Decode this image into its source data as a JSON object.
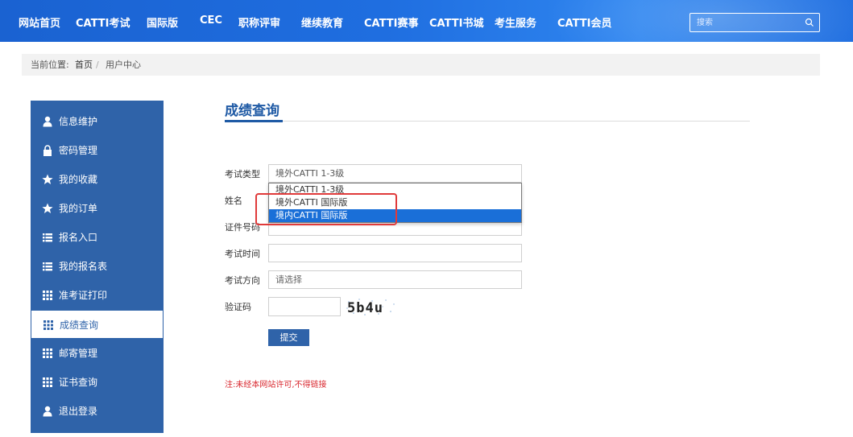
{
  "nav": {
    "items": [
      "网站首页",
      "CATTI考试",
      "国际版",
      "CEC",
      "职称评审",
      "继续教育",
      "CATTI赛事",
      "CATTI书城",
      "考生服务",
      "CATTI会员"
    ],
    "search_placeholder": "搜索",
    "brand_color": "#1f6ee0"
  },
  "breadcrumb": {
    "prefix": "当前位置:",
    "home": "首页",
    "sep": "/",
    "current": "用户中心"
  },
  "sidebar": {
    "items": [
      {
        "label": "信息维护",
        "icon": "user-icon"
      },
      {
        "label": "密码管理",
        "icon": "lock-icon"
      },
      {
        "label": "我的收藏",
        "icon": "star-icon"
      },
      {
        "label": "我的订单",
        "icon": "star-icon"
      },
      {
        "label": "报名入口",
        "icon": "list-icon"
      },
      {
        "label": "我的报名表",
        "icon": "list-icon"
      },
      {
        "label": "准考证打印",
        "icon": "grid-icon"
      },
      {
        "label": "成绩查询",
        "icon": "grid-icon",
        "active": true
      },
      {
        "label": "邮寄管理",
        "icon": "grid-icon"
      },
      {
        "label": "证书查询",
        "icon": "grid-icon"
      },
      {
        "label": "退出登录",
        "icon": "user-icon"
      }
    ],
    "bg_color": "#2f63a9"
  },
  "main": {
    "title": "成绩查询",
    "form": {
      "exam_type_label": "考试类型",
      "exam_type_value": "境外CATTI 1-3级",
      "name_label": "姓名",
      "id_label": "证件号码",
      "exam_time_label": "考试时间",
      "direction_label": "考试方向",
      "direction_placeholder": "请选择",
      "captcha_label": "验证码",
      "captcha_text": "5b4u",
      "submit_label": "提交"
    },
    "dropdown_options": [
      "境外CATTI 1-3级",
      "境外CATTI 国际版",
      "境内CATTI 国际版"
    ],
    "dropdown_selected": "境内CATTI 国际版",
    "notice": "注:未经本网站许可,不得链接"
  }
}
